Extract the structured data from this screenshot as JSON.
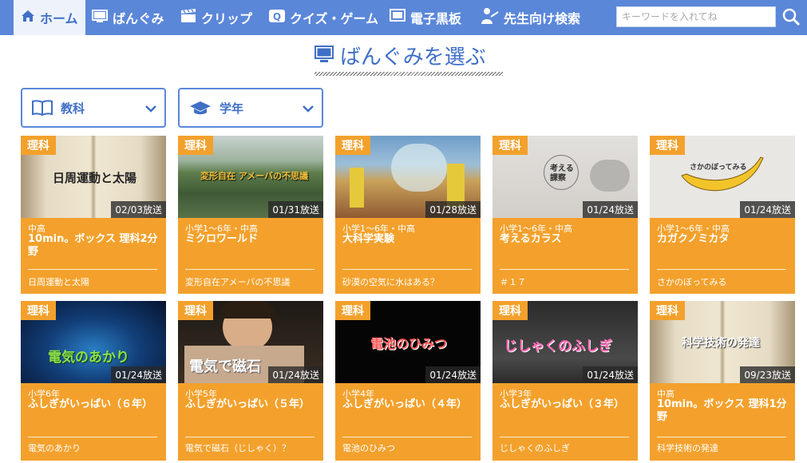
{
  "nav": {
    "items": [
      {
        "label": "ホーム",
        "icon": "home-icon"
      },
      {
        "label": "ばんぐみ",
        "icon": "monitor-icon"
      },
      {
        "label": "クリップ",
        "icon": "clapperboard-icon"
      },
      {
        "label": "クイズ・ゲーム",
        "icon": "quiz-icon"
      },
      {
        "label": "電子黒板",
        "icon": "blackboard-icon"
      },
      {
        "label": "先生向け検索",
        "icon": "teacher-icon"
      }
    ],
    "search_placeholder": "キーワードを入れてね"
  },
  "page_title": "ばんぐみを選ぶ",
  "filters": {
    "subject": "教科",
    "grade": "学年"
  },
  "colors": {
    "nav": "#5b87d9",
    "accent": "#3f6fc6",
    "card": "#f3a12c"
  },
  "cards": [
    {
      "subject": "理科",
      "date": "02/03放送",
      "grade": "中高",
      "title": "10min。ボックス 理科2分野",
      "subtitle": "日周運動と太陽",
      "overlay": "日周運動と太陽"
    },
    {
      "subject": "理科",
      "date": "01/31放送",
      "grade": "小学1〜6年・中高",
      "title": "ミクロワールド",
      "subtitle": "変形自在アメーバの不思議",
      "overlay": "変形自在 アメーバの不思議"
    },
    {
      "subject": "理科",
      "date": "01/28放送",
      "grade": "小学1〜6年・中高",
      "title": "大科学実験",
      "subtitle": "砂漠の空気に水はある？",
      "overlay": ""
    },
    {
      "subject": "理科",
      "date": "01/24放送",
      "grade": "小学1〜6年・中高",
      "title": "考えるカラス",
      "subtitle": "＃１７",
      "overlay": "考える 課察"
    },
    {
      "subject": "理科",
      "date": "01/24放送",
      "grade": "小学1〜6年・中高",
      "title": "カガクノミカタ",
      "subtitle": "さかのぼってみる",
      "overlay": "さかのぼってみる"
    },
    {
      "subject": "理科",
      "date": "01/24放送",
      "grade": "小学6年",
      "title": "ふしぎがいっぱい（６年）",
      "subtitle": "電気のあかり",
      "overlay": "電気のあかり"
    },
    {
      "subject": "理科",
      "date": "01/24放送",
      "grade": "小学5年",
      "title": "ふしぎがいっぱい（５年）",
      "subtitle": "電気で磁石（じしゃく）？",
      "overlay": "電気で磁石"
    },
    {
      "subject": "理科",
      "date": "01/24放送",
      "grade": "小学4年",
      "title": "ふしぎがいっぱい（４年）",
      "subtitle": "電池のひみつ",
      "overlay": "電池のひみつ"
    },
    {
      "subject": "理科",
      "date": "01/24放送",
      "grade": "小学3年",
      "title": "ふしぎがいっぱい（３年）",
      "subtitle": "じしゃくのふしぎ",
      "overlay": "じしゃくのふしぎ"
    },
    {
      "subject": "理科",
      "date": "09/23放送",
      "grade": "中高",
      "title": "10min。ボックス 理科1分野",
      "subtitle": "科学技術の発達",
      "overlay": "科学技術の発達"
    }
  ]
}
